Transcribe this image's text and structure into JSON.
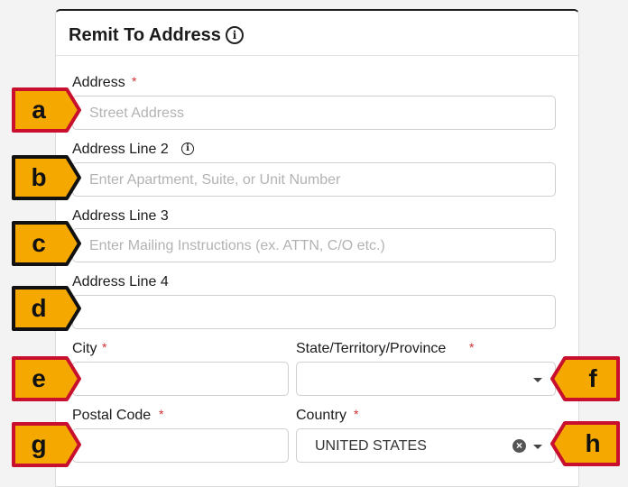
{
  "section": {
    "title": "Remit To Address"
  },
  "fields": {
    "address": {
      "label": "Address",
      "required": "*",
      "placeholder": "Street Address",
      "callout": "a"
    },
    "line2": {
      "label": "Address Line 2",
      "placeholder": "Enter Apartment, Suite, or Unit Number",
      "callout": "b"
    },
    "line3": {
      "label": "Address Line 3",
      "placeholder": "Enter Mailing Instructions (ex. ATTN, C/O etc.)",
      "callout": "c"
    },
    "line4": {
      "label": "Address Line 4",
      "placeholder": "",
      "callout": "d"
    },
    "city": {
      "label": "City",
      "required": "*",
      "callout": "e"
    },
    "state": {
      "label": "State/Territory/Province",
      "required": "*",
      "callout": "f"
    },
    "postal": {
      "label": "Postal Code",
      "required": "*",
      "callout": "g"
    },
    "country": {
      "label": "Country",
      "required": "*",
      "value": "UNITED STATES",
      "callout": "h"
    }
  },
  "colors": {
    "callout_fill": "#f5a800",
    "callout_border_red": "#c8102e",
    "callout_border_black": "#111111",
    "required": "#d32f2f"
  }
}
